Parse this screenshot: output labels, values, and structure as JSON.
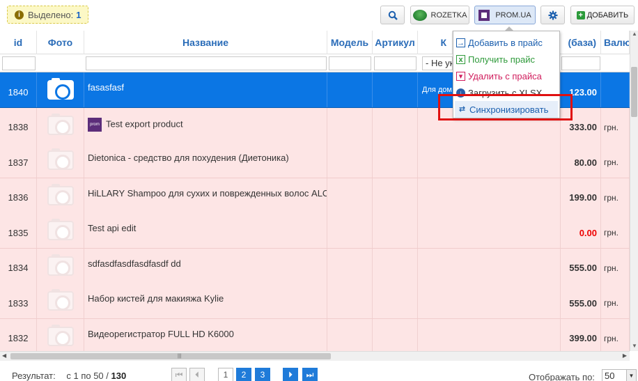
{
  "toolbar": {
    "selected_label": "Выделено:",
    "selected_count": "1",
    "rozetka_label": "ROZETKA",
    "prom_label": "PROM.UA",
    "add_label": "ДОБАВИТЬ"
  },
  "columns": {
    "id": "id",
    "photo": "Фото",
    "name": "Название",
    "model": "Модель",
    "article": "Артикул",
    "category": "К",
    "price": "(база)",
    "currency": "Валю"
  },
  "filters": {
    "category_select": "- Не ук"
  },
  "rows": [
    {
      "id": "1840",
      "name": "fasasfasf",
      "category": "Для дом",
      "price": "123.00",
      "currency": "",
      "selected": true
    },
    {
      "id": "1838",
      "name": "Test export product",
      "category": "",
      "price": "333.00",
      "currency": "грн.",
      "prom_icon": "prom"
    },
    {
      "id": "1837",
      "name": "Dietonica - средство для похудения (Диетоника)",
      "category": "",
      "price": "80.00",
      "currency": "грн."
    },
    {
      "id": "1836",
      "name": "HiLLARY Shampoo для сухих и поврежденных волос ALOE",
      "category": "",
      "price": "199.00",
      "currency": "грн."
    },
    {
      "id": "1835",
      "name": "Test api edit",
      "category": "",
      "price": "0.00",
      "currency": "грн.",
      "negative": true
    },
    {
      "id": "1834",
      "name": "sdfasdfasdfasdfasdf dd",
      "category": "",
      "price": "555.00",
      "currency": "грн."
    },
    {
      "id": "1833",
      "name": "Набор кистей для макияжа Kylie",
      "category": "",
      "price": "555.00",
      "currency": "грн."
    },
    {
      "id": "1832",
      "name": "Видеорегистратор FULL HD K6000",
      "category": "",
      "price": "399.00",
      "currency": "грн."
    }
  ],
  "menu": {
    "add": "Добавить в прайс",
    "get": "Получить прайс",
    "delete": "Удалить с прайса",
    "xlsx": "Загрузить с XLSX",
    "sync": "Синхронизировать"
  },
  "footer": {
    "result_label": "Результат:",
    "range": "с 1 по 50 /",
    "total": "130",
    "pages": [
      "1",
      "2",
      "3"
    ],
    "per_page_label": "Отображать по:",
    "per_page_value": "50"
  },
  "colors": {
    "accent": "#0b76e4",
    "row_bg": "#fde5e5",
    "highlight": "#e01010"
  }
}
